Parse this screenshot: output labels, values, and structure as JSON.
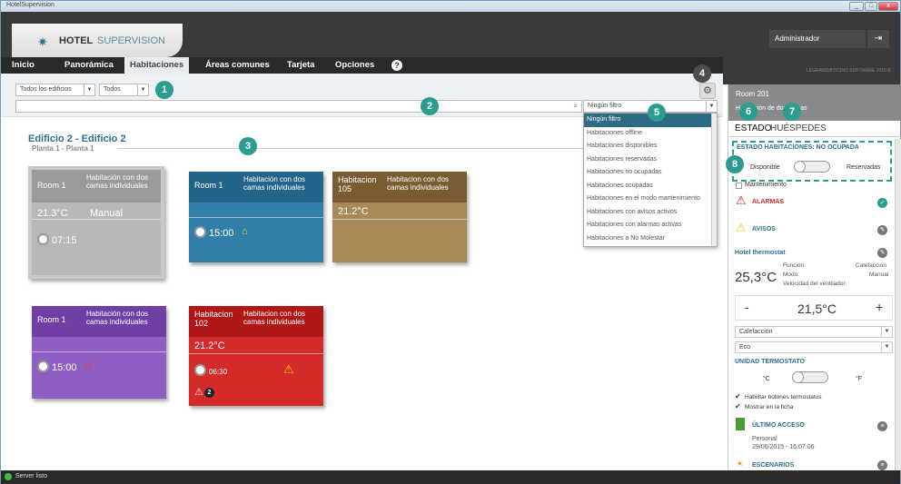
{
  "window": {
    "title": "HotelSupervision"
  },
  "header": {
    "logo_bold": "HOTEL",
    "logo_light": "SUPERVISION",
    "user": "Administrador",
    "version": "LEGRAND/BTICINO SOFTWARE 2015 ©"
  },
  "nav": {
    "tabs": [
      "Inicio",
      "Panorámica",
      "Habitaciones",
      "Áreas comunes",
      "Tarjeta",
      "Opciones"
    ],
    "help": "?"
  },
  "filters": {
    "building": "Todos los edificios",
    "floor": "Todos",
    "search_placeholder": "",
    "filter_value": "Ningún filtro"
  },
  "callouts": [
    "1",
    "2",
    "3",
    "4",
    "5",
    "6",
    "7",
    "8"
  ],
  "section": {
    "title": "Edificio 2 - Edificio 2",
    "subtitle": "Planta 1 - Planta 1"
  },
  "rooms": [
    {
      "name": "Room 1",
      "type": "Habitación con dos camas individuales",
      "temp": "21.3°C",
      "mode": "Manual",
      "time": "07:15",
      "color": "#a8a8a8"
    },
    {
      "name": "Room 1",
      "type": "Habitación con dos camas individuales",
      "temp": "",
      "mode": "",
      "time": "15:00",
      "color": "#2f7fa8"
    },
    {
      "name": "Habitacion 105",
      "type": "Habitacion con dos camas individuales",
      "temp": "21.2°C",
      "mode": "",
      "time": "",
      "color": "#a8895a"
    },
    {
      "name": "Room 1",
      "type": "Habitación con dos camas individuales",
      "temp": "",
      "mode": "",
      "time": "15:00",
      "color": "#8e5ec4"
    },
    {
      "name": "Habitacion 102",
      "type": "Habitacion con dos camas individuales",
      "temp": "21.2°C",
      "mode": "",
      "time": "06:30",
      "color": "#d42a2a",
      "alarm_count": "2"
    }
  ],
  "filter_options": [
    "Ningún filtro",
    "Habitaciones offline",
    "Habitaciones disponibles",
    "Habitaciones reservadas",
    "Habitaciones no ocupadas",
    "Habitaciones ocupadas",
    "Habitaciones en el modo mantenimiento",
    "Habitaciones con avisos activos",
    "Habitaciones con alarmas activas",
    "Habitaciones a No Molestar"
  ],
  "panel": {
    "room": "Room 201",
    "room_sub": "Habitación de dos camas",
    "tabs": [
      "ESTADO",
      "HUÉSPEDES"
    ],
    "estado_title": "ESTADO HABITACIONES: NO OCUPADA",
    "disponible": "Disponible",
    "reservadas": "Reservadas",
    "mantenimiento": "Mantenimiento",
    "alarmas": "ALARMAS",
    "avisos": "AVISOS",
    "thermostat": "Hotel thermostat",
    "current_temp": "25,3°C",
    "funcion_label": "Función:",
    "funcion_value": "Calefacción",
    "modo_label": "Modo:",
    "modo_value": "Manual",
    "velocidad": "Velocidad del ventilador:",
    "minus": "-",
    "setpoint": "21,5°C",
    "plus": "+",
    "sel_function": "Calefacción",
    "sel_mode": "Eco",
    "unidad": "UNIDAD TERMOSTATO",
    "unit_c": "°C",
    "unit_f": "°F",
    "check1": "Habilitar botones termostatos",
    "check2": "Mostrar en la ficha",
    "ultimo": "ÚLTIMO ACCESO",
    "ultimo_who": "Personal",
    "ultimo_when": "29/06/2015 - 16:07:06",
    "escenarios": "ESCENARIOS"
  },
  "status": {
    "text": "Server listo"
  }
}
